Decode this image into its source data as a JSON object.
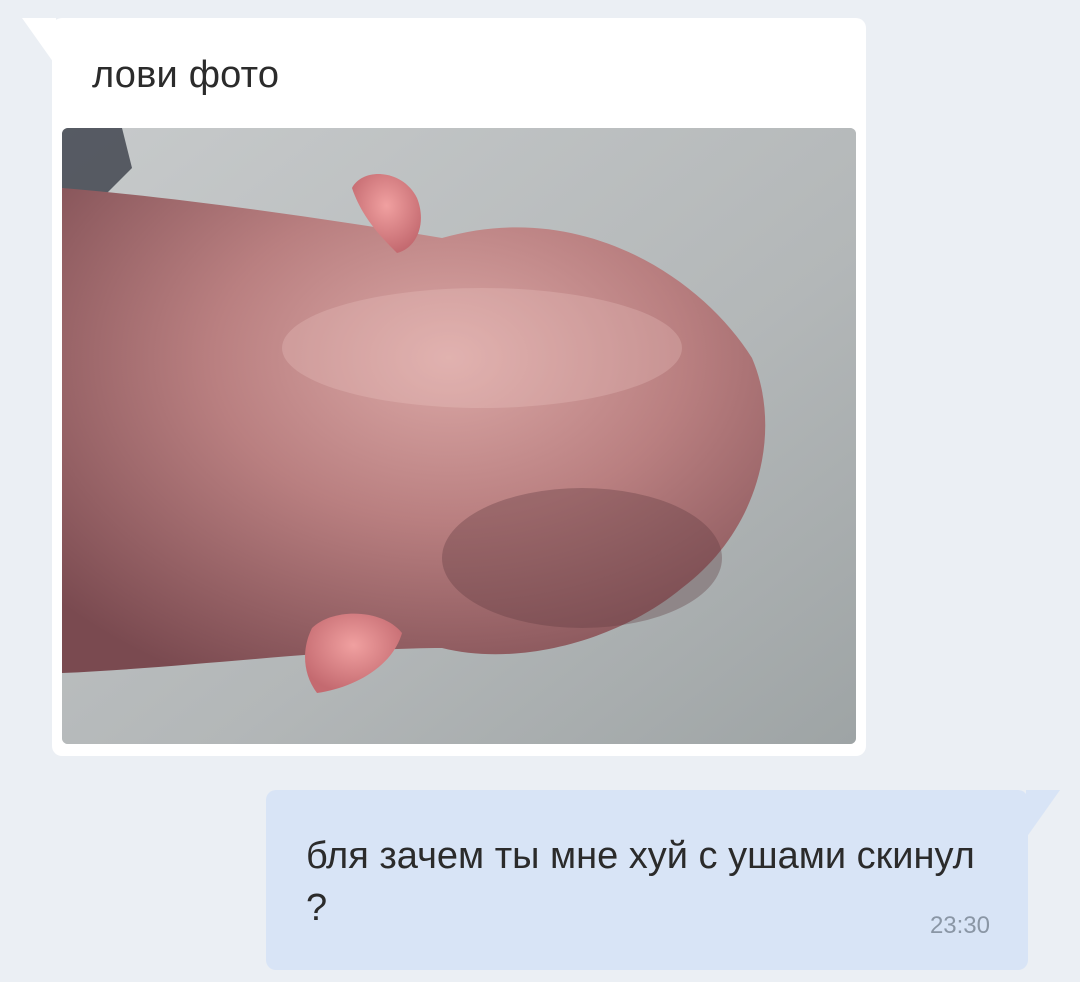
{
  "colors": {
    "background": "#ebeff4",
    "incoming_bubble": "#ffffff",
    "outgoing_bubble": "#d8e4f6",
    "time_text": "#8a96a5"
  },
  "incoming_message": {
    "text": "лови фото",
    "attachment": "photo"
  },
  "outgoing_message": {
    "text": "бля зачем ты мне хуй с ушами скинул ?",
    "time": "23:30"
  }
}
